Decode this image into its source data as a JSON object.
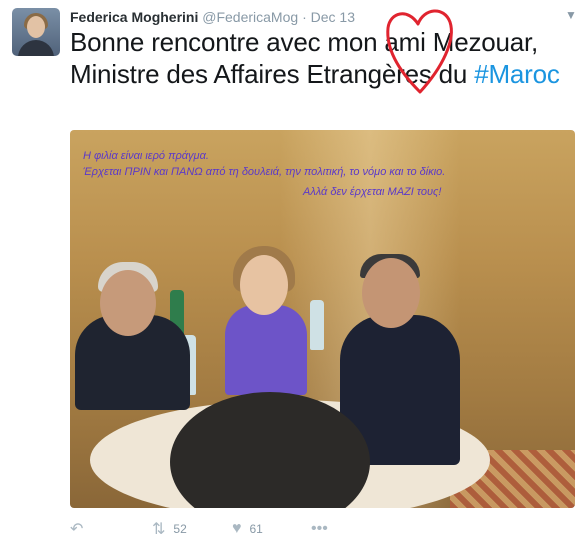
{
  "tweet": {
    "author_name": "Federica Mogherini",
    "author_handle": "@FedericaMog",
    "separator": "·",
    "date": "Dec 13",
    "text_prefix": "Bonne rencontre avec mon ami Mezouar, Ministre des Affaires Etrangères du ",
    "hashtag": "#Maroc"
  },
  "photo": {
    "overlay_line1": "Η φιλία είναι ιερό πράγμα.",
    "overlay_line2": "Έρχεται ΠΡΙΝ και ΠΑΝΩ από τη δουλειά, την πολιτική, το νόμο και το δίκιο.",
    "overlay_line3": "Αλλά δεν έρχεται ΜΑΖΙ τους!",
    "overlay_color": "#5b39c9"
  },
  "annotation": {
    "heart_color": "#e0242f"
  },
  "actions": {
    "reply_icon": "reply-icon",
    "retweet_icon": "retweet-icon",
    "retweet_count": "52",
    "like_icon": "heart-icon",
    "like_count": "61",
    "more_icon": "more-icon"
  }
}
